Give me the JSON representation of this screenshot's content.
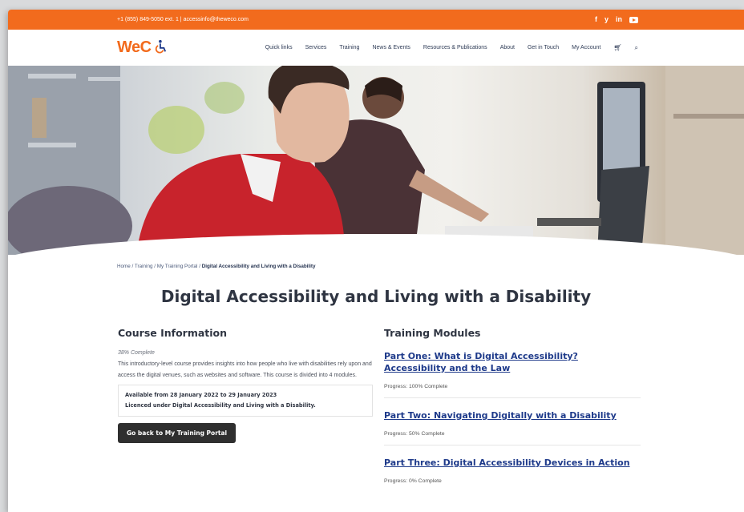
{
  "topbar": {
    "contact": "+1 (855) 849-5050 ext. 1 | accessinfo@theweco.com",
    "social": [
      "f",
      "y",
      "in"
    ]
  },
  "nav": {
    "logo": "WeC",
    "items": [
      "Quick links",
      "Services",
      "Training",
      "News & Events",
      "Resources & Publications",
      "About",
      "Get in Touch",
      "My Account"
    ]
  },
  "breadcrumb": {
    "path": "Home / Training / My Training Portal / ",
    "current": "Digital Accessibility and Living with a Disability"
  },
  "page_title": "Digital Accessibility and Living with a Disability",
  "course": {
    "heading": "Course Information",
    "progress": "38% Complete",
    "description": "This introductory-level course provides insights into how people who live with disabilities rely upon and access the digital venues, such as websites and software. This course is divided into 4 modules.",
    "available": "Available from 28 January 2022 to 29 January 2023",
    "licence": "Licenced under Digital Accessibility and Living with a Disability.",
    "button": "Go back to My Training Portal"
  },
  "modules": {
    "heading": "Training Modules",
    "items": [
      {
        "title": "Part One: What is Digital Accessibility? Accessibility and the Law",
        "progress": "Progress: 100% Complete"
      },
      {
        "title": "Part Two: Navigating Digitally with a Disability",
        "progress": "Progress: 50% Complete"
      },
      {
        "title": "Part Three: Digital Accessibility Devices in Action",
        "progress": "Progress: 0% Complete"
      }
    ]
  },
  "colors": {
    "brand_orange": "#f26b1d",
    "link_blue": "#1e3a8a"
  }
}
